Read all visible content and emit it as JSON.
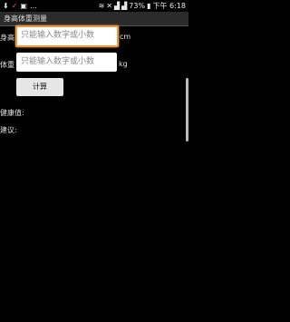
{
  "statusbar": {
    "left_icons": [
      "download-icon",
      "check-icon",
      "image-icon",
      "more-icon"
    ],
    "signal_icons": [
      "wifi-icon",
      "mute-icon",
      "signal-icon",
      "signal-icon"
    ],
    "battery_percent": "73%",
    "time": "下午 6:18"
  },
  "app": {
    "title": "身高体重测量"
  },
  "form": {
    "height_label": "身高",
    "height_placeholder": "只能输入数字或小数",
    "height_unit": "cm",
    "weight_label": "体重",
    "weight_placeholder": "只能输入数字或小数",
    "weight_unit": "kg",
    "calc_button": "计算"
  },
  "results": {
    "health_label": "健康值:",
    "advice_label": "建议:"
  }
}
